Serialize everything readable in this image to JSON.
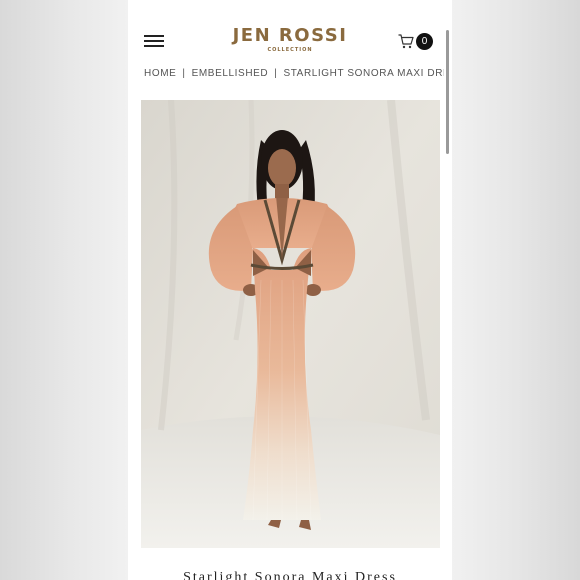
{
  "header": {
    "brand_name": "JEN ROSSI",
    "brand_sub": "COLLECTION",
    "cart_count": "0",
    "icons": {
      "menu": "hamburger-icon",
      "cart": "shopping-cart-icon"
    }
  },
  "breadcrumb": {
    "items": [
      "HOME",
      "EMBELLISHED",
      "STARLIGHT SONORA MAXI DRESS"
    ],
    "separator": "|"
  },
  "product": {
    "title": "Starlight Sonora Maxi Dress"
  },
  "colors": {
    "brand": "#8a6a3e",
    "text": "#222222",
    "badge": "#111111",
    "dress": "#e6ab88"
  }
}
